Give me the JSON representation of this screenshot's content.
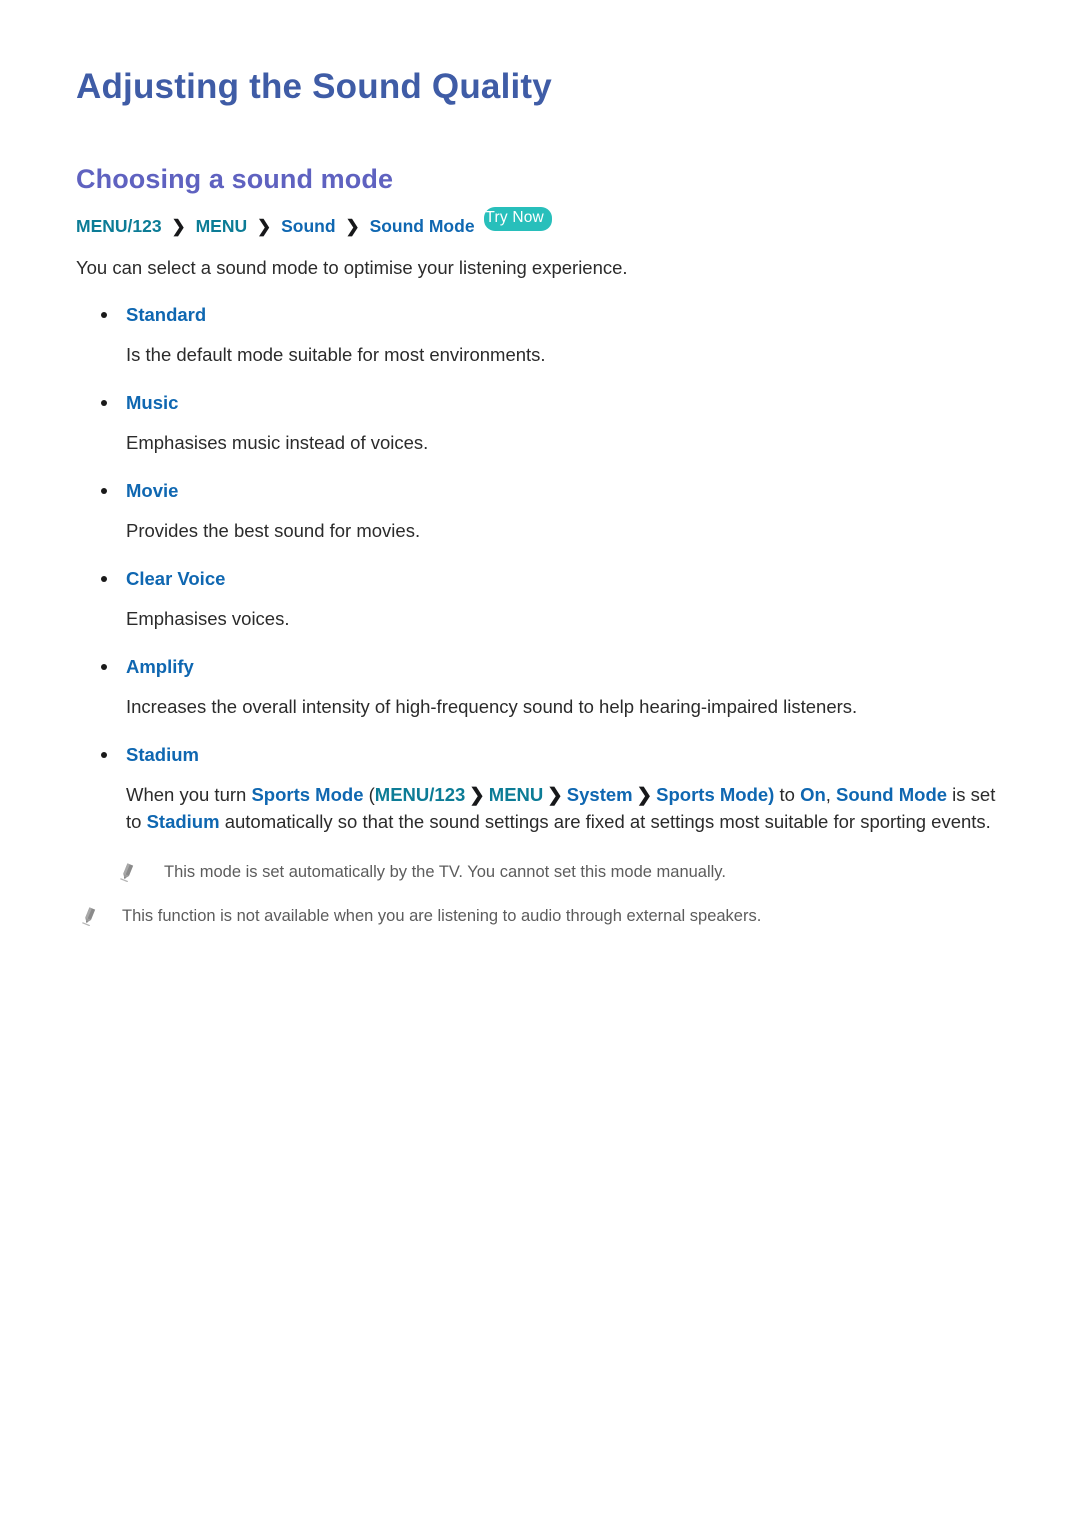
{
  "document": {
    "title": "Adjusting the Sound Quality",
    "section_heading": "Choosing a sound mode"
  },
  "breadcrumb": {
    "items": [
      {
        "label": "MENU/123",
        "color": "#0c7c96"
      },
      {
        "label": "MENU",
        "color": "#0c7c96"
      },
      {
        "label": "Sound",
        "color": "#0f67b1"
      },
      {
        "label": "Sound Mode",
        "color": "#0f67b1"
      }
    ],
    "separator": "❯",
    "badge": "Try Now"
  },
  "intro": "You can select a sound mode to optimise your listening experience.",
  "modes": [
    {
      "name": "Standard",
      "description": "Is the default mode suitable for most environments."
    },
    {
      "name": "Music",
      "description": "Emphasises music instead of voices."
    },
    {
      "name": "Movie",
      "description": "Provides the best sound for movies."
    },
    {
      "name": "Clear Voice",
      "description": "Emphasises voices."
    },
    {
      "name": "Amplify",
      "description": "Increases the overall intensity of high-frequency sound to help hearing-impaired listeners."
    },
    {
      "name": "Stadium",
      "description": ""
    }
  ],
  "stadium_paragraph": {
    "p1": "When you turn ",
    "sports_mode_1": "Sports Mode",
    "open_paren": " (",
    "menu123": "MENU/123",
    "menu": "MENU",
    "system": "System",
    "sports_mode_2": "Sports Mode",
    "close_paren": ")",
    "p2": " to ",
    "on": "On",
    "comma": ", ",
    "sound_mode": "Sound Mode",
    "p3": " is set to ",
    "stadium": "Stadium",
    "p4": " automatically so that the sound settings are fixed at settings most suitable for sporting events."
  },
  "notes": [
    {
      "icon": "pencil-icon",
      "text": "This mode is set automatically by the TV. You cannot set this mode manually."
    },
    {
      "icon": "pencil-icon",
      "text": "This function is not available when you are listening to audio through external speakers."
    }
  ],
  "colors": {
    "title": "#3f5ca6",
    "heading": "#5f62c0",
    "blue": "#0f67b1",
    "teal": "#0c7c96",
    "badge_bg": "#28bfbb",
    "body": "#2b2b2b",
    "note": "#5c5c5c"
  }
}
